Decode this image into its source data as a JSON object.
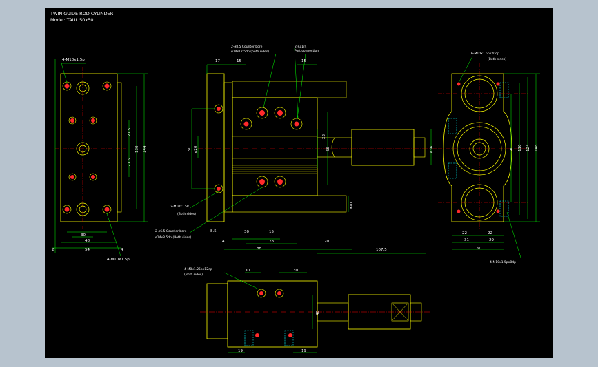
{
  "title": "TWIN GUIDE ROD CYLINDER",
  "model": "Model: TAUL 50x50",
  "colors": {
    "background": "#000000",
    "outline": "#ffff00",
    "hole": "#ff2a2a",
    "dim": "#00ff00",
    "centerline": "#ff0000",
    "hidden": "#00ffff",
    "text": "#ffffff",
    "frame": "#b7c3ce"
  },
  "labels": {
    "front_top": "4-M10x1.5p",
    "front_bottom": "4-M10x1.5p",
    "mid_top_a": "2-ø8.5 Counter bore",
    "mid_top_a2": "ø14x17.5dp (both sides)",
    "mid_top_b": "2-Rc1/4",
    "mid_top_b2": "Port connection",
    "mid_left_a": "2-M10x1.5P",
    "mid_left_a2": "(Both sides)",
    "mid_left_b": "2-ø6.5 Counter bore",
    "mid_left_b2": "ø14x8.5dp (Both sides)",
    "right_top": "6-M10x1.5px20dp",
    "right_top2": "(Both sides)",
    "right_bottom": "4-M10x1.5px8dp",
    "bottom_top": "4-M8x1.25px12dp",
    "bottom_top2": "(Both sides)"
  },
  "dims": {
    "d2": "2",
    "d54": "54",
    "d48": "48",
    "d30": "30",
    "d4": "4",
    "d27_5a": "27.5",
    "d27_5b": "27.5",
    "d130": "130",
    "d144": "144",
    "d17": "17",
    "d15a": "15",
    "d15b": "15",
    "d50": "50",
    "d20": "ø20",
    "d88": "88",
    "d8_5": "8.5",
    "d30b": "30",
    "d78": "78",
    "d15c": "15",
    "d4b": "4",
    "d20b": "20",
    "d107_5": "107.5",
    "d23": "23",
    "d56": "56",
    "d36": "ø36",
    "d20c": "ø20",
    "r22a": "22",
    "r22b": "22",
    "r31": "31",
    "r29": "29",
    "r60": "60",
    "r90": "90",
    "r110": "110",
    "r124": "124",
    "r148": "148",
    "b30a": "30",
    "b30b": "30",
    "b40": "40",
    "b19a": "19",
    "b19b": "19"
  }
}
